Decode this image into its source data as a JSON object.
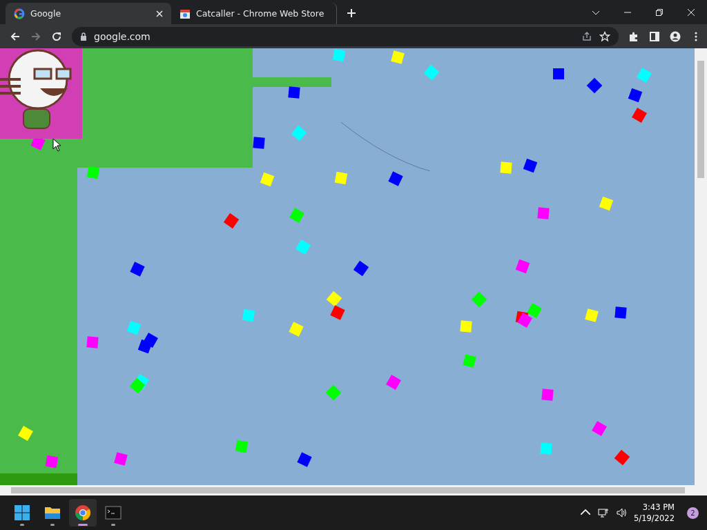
{
  "tabs": [
    {
      "title": "Google",
      "selected": true,
      "kind": "google"
    },
    {
      "title": "Catcaller - Chrome Web Store",
      "selected": false,
      "kind": "store"
    }
  ],
  "address_bar": {
    "url": "google.com"
  },
  "taskbar": {
    "apps": [
      {
        "kind": "windows",
        "selected": false
      },
      {
        "kind": "folder",
        "selected": false
      },
      {
        "kind": "chrome",
        "selected": true
      },
      {
        "kind": "terminal",
        "selected": false
      }
    ],
    "time": "3:43 PM",
    "date": "5/19/2022",
    "notification_count": "2"
  }
}
